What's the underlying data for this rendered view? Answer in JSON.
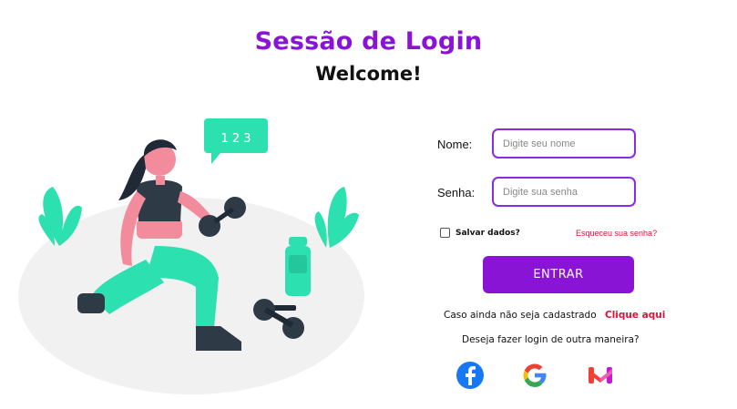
{
  "header": {
    "title": "Sessão de Login",
    "subtitle": "Welcome!"
  },
  "illustration": {
    "speech_bubble_text": "1 2 3",
    "colors": {
      "accent": "#2de0b0",
      "skin": "#f28b9b",
      "hair": "#1f2a36",
      "floor": "#f1f1f1"
    }
  },
  "form": {
    "name_label": "Nome:",
    "name_placeholder": "Digite seu nome",
    "password_label": "Senha:",
    "password_placeholder": "Digite sua senha",
    "remember_label": "Salvar dados?",
    "forgot_link": "Esqueceu sua senha?",
    "submit_label": "ENTRAR",
    "register_text": "Caso ainda não seja cadastrado",
    "register_link": "Clique aqui",
    "other_login_text": "Deseja fazer login de outra maneira?"
  },
  "social": [
    {
      "name": "facebook-icon",
      "color": "#1877f2"
    },
    {
      "name": "google-icon",
      "color": "#4285f4"
    },
    {
      "name": "gmail-icon",
      "color": "#ea4335"
    }
  ],
  "colors": {
    "brand_purple": "#8a14d6",
    "input_border": "#8a2be2",
    "link_red": "#d9143a"
  }
}
